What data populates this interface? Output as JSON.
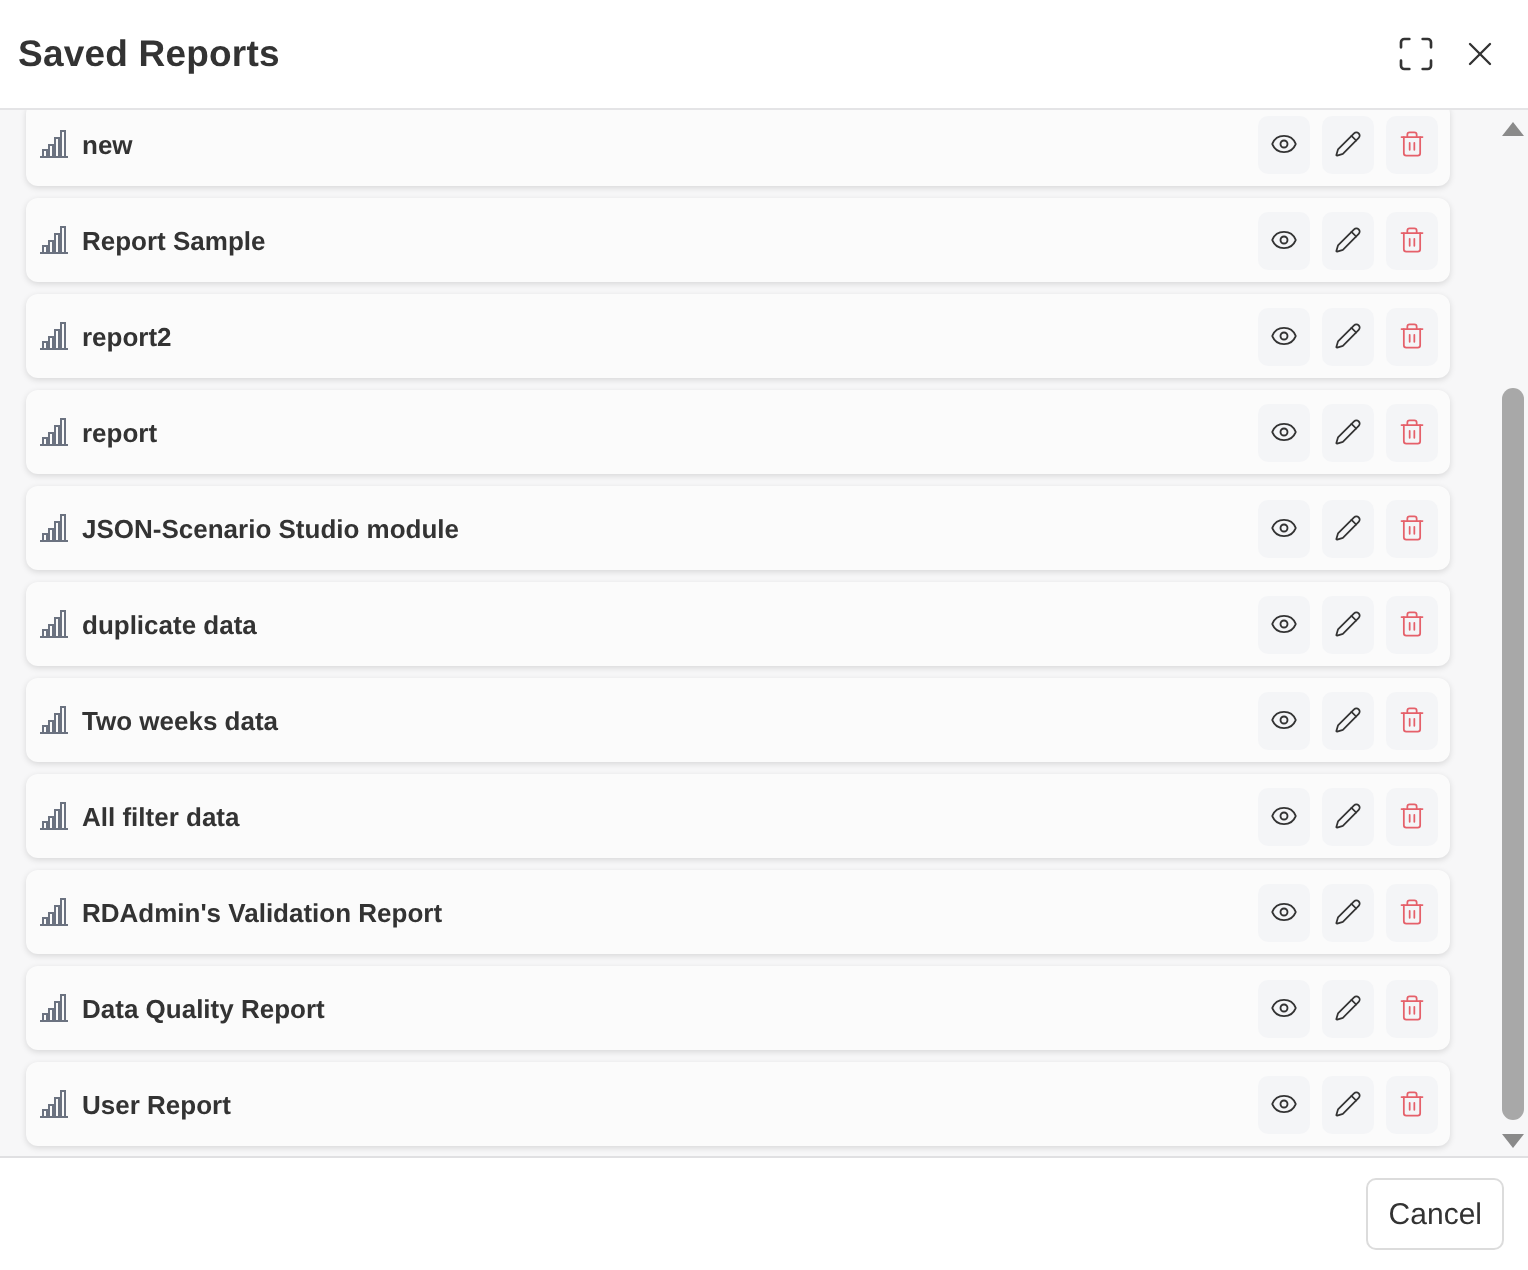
{
  "dialog": {
    "title": "Saved Reports"
  },
  "reports": [
    {
      "name": "new"
    },
    {
      "name": "Report Sample"
    },
    {
      "name": "report2"
    },
    {
      "name": "report"
    },
    {
      "name": "JSON-Scenario Studio module"
    },
    {
      "name": "duplicate data"
    },
    {
      "name": "Two weeks data"
    },
    {
      "name": "All filter data"
    },
    {
      "name": "RDAdmin's Validation Report"
    },
    {
      "name": "Data Quality Report"
    },
    {
      "name": "User Report"
    }
  ],
  "footer": {
    "cancel_button": "Cancel"
  }
}
